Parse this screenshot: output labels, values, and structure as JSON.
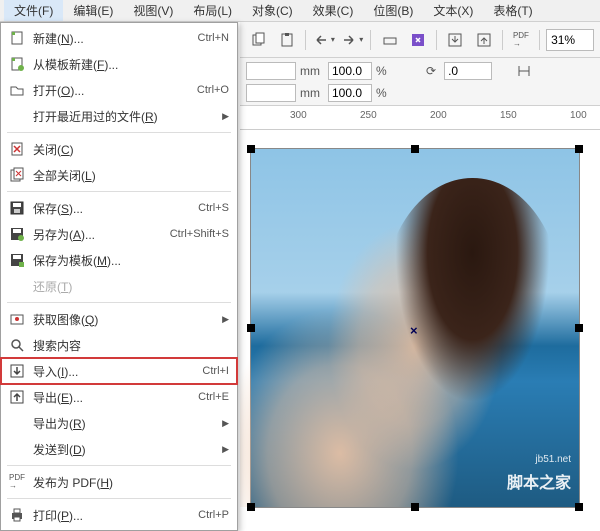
{
  "menubar": {
    "items": [
      {
        "label": "文件(F)",
        "active": true
      },
      {
        "label": "编辑(E)",
        "active": false
      },
      {
        "label": "视图(V)",
        "active": false
      },
      {
        "label": "布局(L)",
        "active": false
      },
      {
        "label": "对象(C)",
        "active": false
      },
      {
        "label": "效果(C)",
        "active": false
      },
      {
        "label": "位图(B)",
        "active": false
      },
      {
        "label": "文本(X)",
        "active": false
      },
      {
        "label": "表格(T)",
        "active": false
      }
    ]
  },
  "toolbar": {
    "zoom": "31%"
  },
  "propbar": {
    "row1": {
      "value": "",
      "unit": "mm",
      "pct": "100.0"
    },
    "row2": {
      "value": "",
      "unit": "mm",
      "pct": "100.0"
    },
    "rotation": ".0"
  },
  "ruler": {
    "ticks": [
      {
        "label": "300",
        "pos": 50
      },
      {
        "label": "250",
        "pos": 120
      },
      {
        "label": "200",
        "pos": 190
      },
      {
        "label": "150",
        "pos": 260
      },
      {
        "label": "100",
        "pos": 330
      }
    ]
  },
  "file_menu": {
    "items": [
      {
        "icon": "new-icon",
        "label": "新建(N)...",
        "shortcut": "Ctrl+N",
        "arrow": false
      },
      {
        "icon": "new-template-icon",
        "label": "从模板新建(F)...",
        "shortcut": "",
        "arrow": false
      },
      {
        "icon": "open-icon",
        "label": "打开(O)...",
        "shortcut": "Ctrl+O",
        "arrow": false
      },
      {
        "icon": "",
        "label": "打开最近用过的文件(R)",
        "shortcut": "",
        "arrow": true
      },
      {
        "sep": true
      },
      {
        "icon": "close-icon",
        "label": "关闭(C)",
        "shortcut": "",
        "arrow": false
      },
      {
        "icon": "close-all-icon",
        "label": "全部关闭(L)",
        "shortcut": "",
        "arrow": false
      },
      {
        "sep": true
      },
      {
        "icon": "save-icon",
        "label": "保存(S)...",
        "shortcut": "Ctrl+S",
        "arrow": false
      },
      {
        "icon": "save-as-icon",
        "label": "另存为(A)...",
        "shortcut": "Ctrl+Shift+S",
        "arrow": false
      },
      {
        "icon": "save-template-icon",
        "label": "保存为模板(M)...",
        "shortcut": "",
        "arrow": false
      },
      {
        "icon": "",
        "label": "还原(T)",
        "shortcut": "",
        "arrow": false,
        "disabled": true
      },
      {
        "sep": true
      },
      {
        "icon": "acquire-icon",
        "label": "获取图像(Q)",
        "shortcut": "",
        "arrow": true
      },
      {
        "icon": "search-icon",
        "label": "搜索内容",
        "shortcut": "",
        "arrow": false
      },
      {
        "icon": "import-icon",
        "label": "导入(I)...",
        "shortcut": "Ctrl+I",
        "arrow": false,
        "highlighted": true
      },
      {
        "icon": "export-icon",
        "label": "导出(E)...",
        "shortcut": "Ctrl+E",
        "arrow": false
      },
      {
        "icon": "",
        "label": "导出为(R)",
        "shortcut": "",
        "arrow": true
      },
      {
        "icon": "",
        "label": "发送到(D)",
        "shortcut": "",
        "arrow": true
      },
      {
        "sep": true
      },
      {
        "icon": "pdf-icon",
        "label": "发布为 PDF(H)",
        "shortcut": "",
        "arrow": false
      },
      {
        "sep": true
      },
      {
        "icon": "print-icon",
        "label": "打印(P)...",
        "shortcut": "Ctrl+P",
        "arrow": false
      }
    ]
  },
  "watermark": {
    "url": "jb51.net",
    "text": "脚本之家"
  }
}
